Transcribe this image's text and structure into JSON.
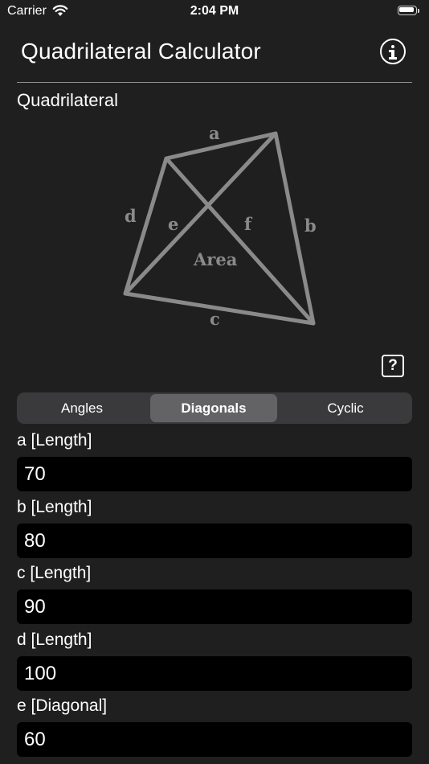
{
  "status_bar": {
    "carrier": "Carrier",
    "time": "2:04 PM"
  },
  "header": {
    "title": "Quadrilateral Calculator",
    "info_icon": "info-circle-icon"
  },
  "section": {
    "label": "Quadrilateral"
  },
  "diagram": {
    "side_a": "a",
    "side_b": "b",
    "side_c": "c",
    "side_d": "d",
    "diag_e": "e",
    "diag_f": "f",
    "area": "Area",
    "color": "#8a8a8a"
  },
  "help_icon_label": "?",
  "tabs": [
    {
      "label": "Angles",
      "selected": false
    },
    {
      "label": "Diagonals",
      "selected": true
    },
    {
      "label": "Cyclic",
      "selected": false
    }
  ],
  "fields": [
    {
      "label": "a [Length]",
      "value": "70"
    },
    {
      "label": "b [Length]",
      "value": "80"
    },
    {
      "label": "c [Length]",
      "value": "90"
    },
    {
      "label": "d [Length]",
      "value": "100"
    },
    {
      "label": "e [Diagonal]",
      "value": "60"
    }
  ],
  "colors": {
    "background": "#1f1f1f",
    "field_bg": "#000000",
    "segment_bg": "#3a3a3c",
    "segment_selected": "#636366"
  }
}
